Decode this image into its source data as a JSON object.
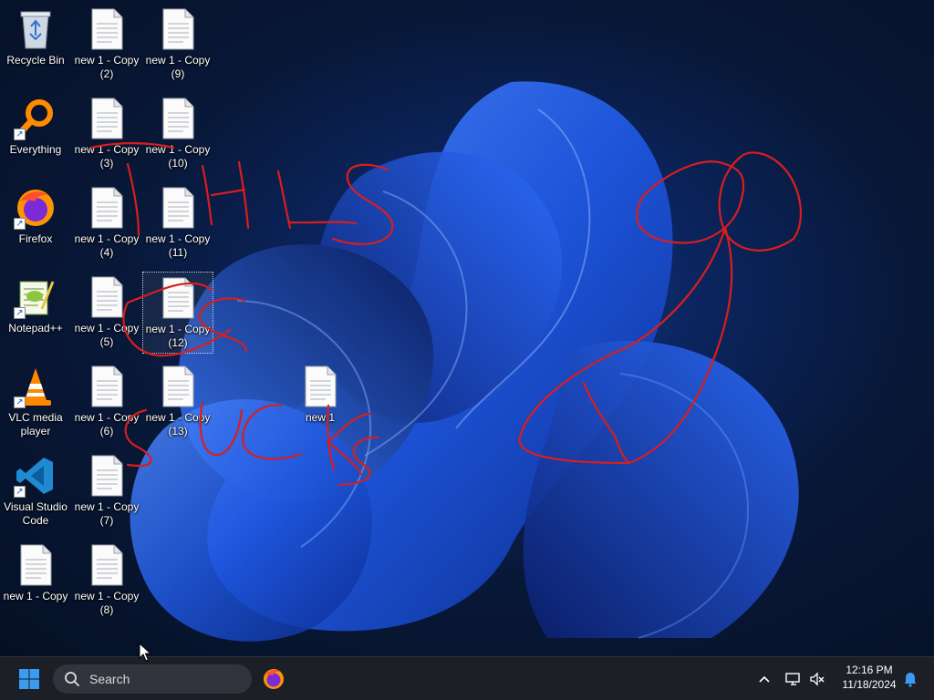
{
  "desktop": {
    "icons": [
      {
        "id": "recycle-bin",
        "label": "Recycle Bin",
        "type": "recycle"
      },
      {
        "id": "everything",
        "label": "Everything",
        "type": "everything"
      },
      {
        "id": "firefox",
        "label": "Firefox",
        "type": "firefox"
      },
      {
        "id": "notepadpp",
        "label": "Notepad++",
        "type": "notepadpp"
      },
      {
        "id": "vlc",
        "label": "VLC media player",
        "type": "vlc"
      },
      {
        "id": "vscode",
        "label": "Visual Studio Code",
        "type": "vscode"
      },
      {
        "id": "doc-copy",
        "label": "new 1 - Copy",
        "type": "doc"
      },
      {
        "id": "doc-2",
        "label": "new 1 - Copy (2)",
        "type": "doc"
      },
      {
        "id": "doc-3",
        "label": "new 1 - Copy (3)",
        "type": "doc"
      },
      {
        "id": "doc-4",
        "label": "new 1 - Copy (4)",
        "type": "doc"
      },
      {
        "id": "doc-5",
        "label": "new 1 - Copy (5)",
        "type": "doc"
      },
      {
        "id": "doc-6",
        "label": "new 1 - Copy (6)",
        "type": "doc"
      },
      {
        "id": "doc-7",
        "label": "new 1 - Copy (7)",
        "type": "doc"
      },
      {
        "id": "doc-8",
        "label": "new 1 - Copy (8)",
        "type": "doc"
      },
      {
        "id": "doc-9",
        "label": "new 1 - Copy (9)",
        "type": "doc"
      },
      {
        "id": "doc-10",
        "label": "new 1 - Copy (10)",
        "type": "doc"
      },
      {
        "id": "doc-11",
        "label": "new 1 - Copy (11)",
        "type": "doc"
      },
      {
        "id": "doc-12",
        "label": "new 1 - Copy (12)",
        "type": "doc",
        "selected": true
      },
      {
        "id": "doc-13",
        "label": "new 1 - Copy (13)",
        "type": "doc"
      },
      {
        "id": "doc-new1",
        "label": "new 1",
        "type": "doc"
      }
    ]
  },
  "taskbar": {
    "search_placeholder": "Search",
    "pinned": [
      {
        "name": "Firefox",
        "icon": "firefox-icon"
      }
    ],
    "tray_icons": [
      "chevron-up-icon",
      "network-icon",
      "volume-muted-icon",
      "notification-bell-icon"
    ],
    "time": "12:16 PM",
    "date": "11/18/2024"
  },
  "colors": {
    "taskbar_bg": "#1c1f26",
    "start_accent": "#3a9bf0",
    "scribble": "#d81e1e",
    "wallpaper_bloom": "#1f57e0"
  }
}
